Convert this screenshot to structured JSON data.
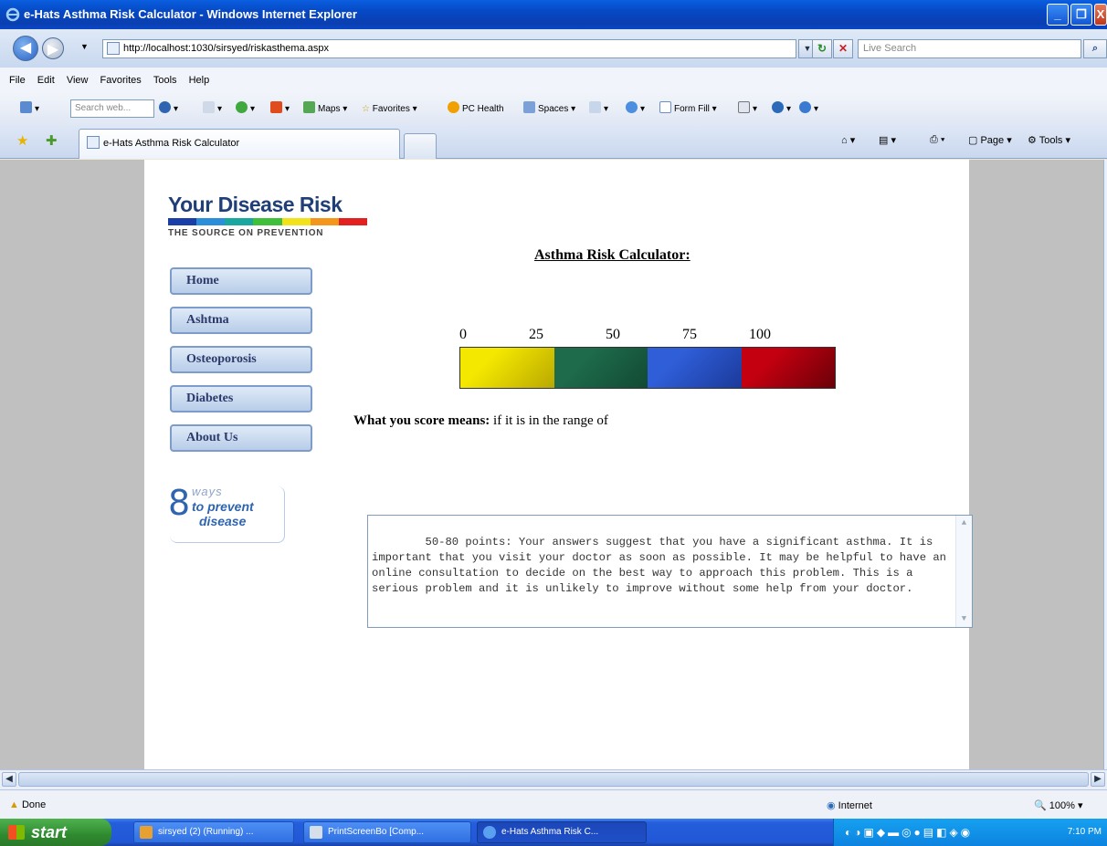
{
  "window": {
    "title": "e-Hats Asthma Risk Calculator - Windows Internet Explorer",
    "min_label": "_",
    "max_label": "❐",
    "close_label": "X"
  },
  "address": {
    "back": "◀",
    "forward": "▶",
    "url": "http://localhost:1030/sirsyed/riskasthema.aspx",
    "search_placeholder": "Live Search",
    "refresh": "↻",
    "stop": "✕",
    "go": "⌕"
  },
  "menu": {
    "items": [
      "File",
      "Edit",
      "View",
      "Favorites",
      "Tools",
      "Help"
    ]
  },
  "toolbar": {
    "search_placeholder": "Search web...",
    "maps": "Maps",
    "favorites": "Favorites",
    "pc_health": "PC Health",
    "spaces": "Spaces",
    "form_fill": "Form Fill"
  },
  "tabs": {
    "active_title": "e-Hats Asthma Risk Calculator",
    "page_cmd": "Page",
    "tools_cmd": "Tools"
  },
  "site": {
    "logo_title": "Your Disease Risk",
    "logo_tagline": "THE SOURCE ON PREVENTION",
    "logo_colors": [
      "#1a3ea8",
      "#2a8fd8",
      "#1aa7a0",
      "#3fbf3a",
      "#f2e21a",
      "#f4961c",
      "#e32020"
    ],
    "nav": [
      "Home",
      "Ashtma",
      "Osteoporosis",
      "Diabetes",
      "About Us"
    ],
    "ways_number": "8",
    "ways_line1": "ways",
    "ways_line2": "to prevent",
    "ways_line3": "disease"
  },
  "calculator": {
    "title": "Asthma Risk Calculator:",
    "scale_labels": [
      "0",
      "25",
      "50",
      "75",
      "100"
    ],
    "gauge_colors": [
      "#f4e800",
      "#1e6b4c",
      "#2f5ed8",
      "#c40010"
    ],
    "meaning_label": "What you score means:",
    "meaning_text": " if it is in the range of",
    "result_text": "50-80 points: Your answers suggest that you have a significant asthma. It is important that you visit your doctor as soon as possible. It may be helpful to have an online consultation to decide on the best way to approach this problem. This is a serious problem and it is unlikely to improve without some help from your doctor."
  },
  "status": {
    "done": "Done",
    "zone": "Internet",
    "zoom": "100%"
  },
  "taskbar": {
    "start": "start",
    "tasks": [
      "sirsyed (2) (Running) ...",
      "PrintScreenBo [Comp...",
      "e-Hats Asthma Risk C..."
    ],
    "clock": "7:10 PM"
  }
}
